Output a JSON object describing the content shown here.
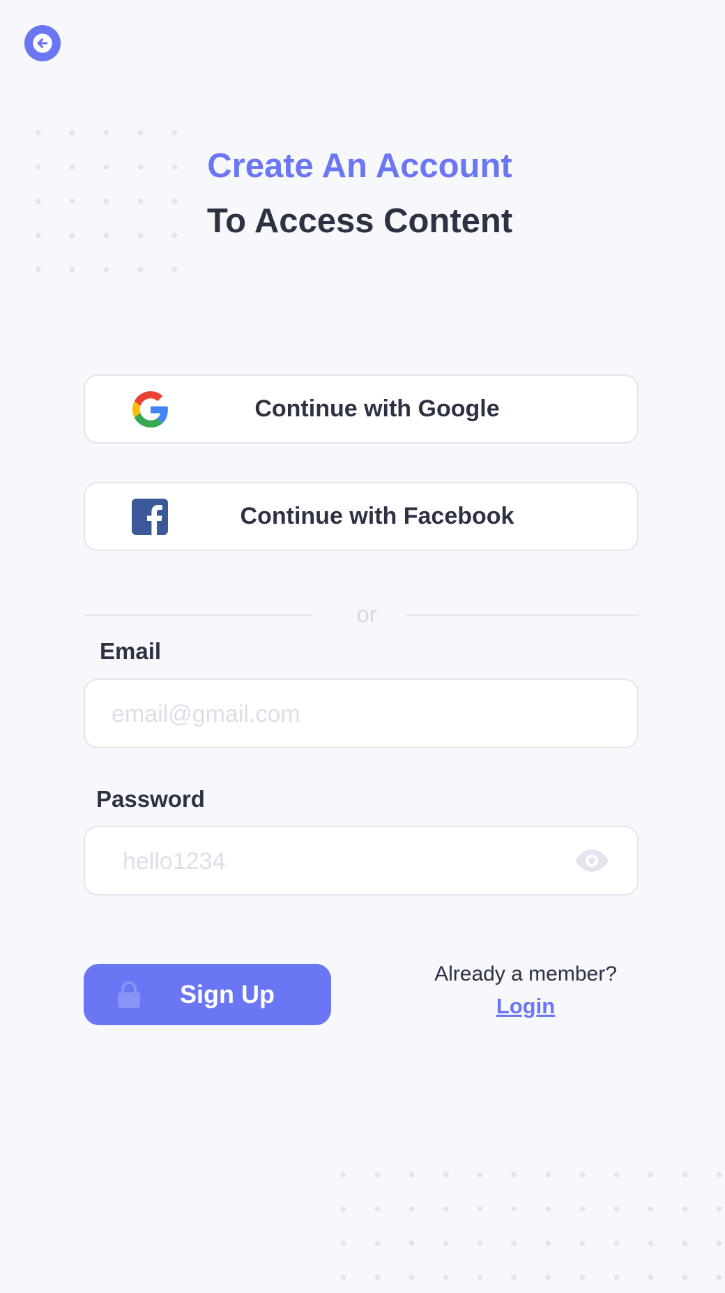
{
  "header": {
    "back_icon": "arrow-left-icon",
    "title_line1": "Create An Account",
    "title_line2": "To Access Content"
  },
  "social": {
    "google_label": "Continue with Google",
    "google_icon": "google-icon",
    "facebook_label": "Continue with Facebook",
    "facebook_icon": "facebook-icon"
  },
  "divider": {
    "text": "or"
  },
  "form": {
    "email_label": "Email",
    "email_placeholder": "email@gmail.com",
    "email_value": "",
    "password_label": "Password",
    "password_placeholder": "hello1234",
    "password_value": "",
    "password_toggle_icon": "eye-icon"
  },
  "actions": {
    "signup_label": "Sign Up",
    "signup_icon": "lock-icon",
    "member_text": "Already a member?",
    "login_label": "Login"
  },
  "colors": {
    "accent": "#6a76f3",
    "text_dark": "#2d3142",
    "background": "#f7f8fb",
    "facebook": "#3b5998"
  }
}
